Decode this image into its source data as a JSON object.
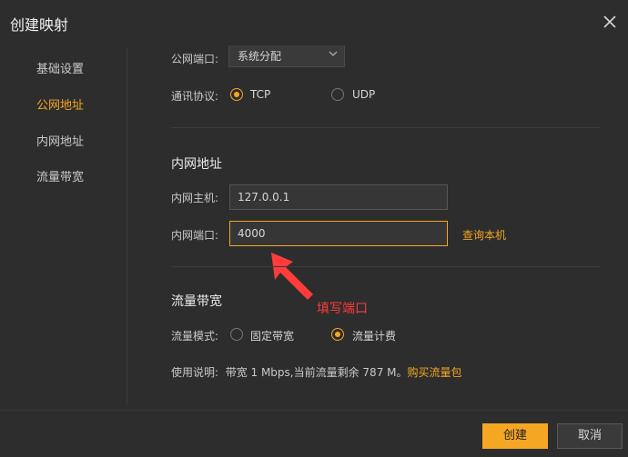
{
  "dialog": {
    "title": "创建映射"
  },
  "sidebar": {
    "items": [
      {
        "label": "基础设置",
        "active": false
      },
      {
        "label": "公网地址",
        "active": true
      },
      {
        "label": "内网地址",
        "active": false
      },
      {
        "label": "流量带宽",
        "active": false
      }
    ]
  },
  "public": {
    "port_label": "公网端口:",
    "port_value": "系统分配",
    "protocol_label": "通讯协议:",
    "protocol_options": [
      "TCP",
      "UDP"
    ],
    "protocol_selected": "TCP"
  },
  "intranet": {
    "section_title": "内网地址",
    "host_label": "内网主机:",
    "host_value": "127.0.0.1",
    "port_label": "内网端口:",
    "port_value": "4000",
    "query_link": "查询本机",
    "annotation": "填写端口"
  },
  "bandwidth": {
    "section_title": "流量带宽",
    "mode_label": "流量模式:",
    "mode_options": [
      "固定带宽",
      "流量计费"
    ],
    "mode_selected": "流量计费",
    "usage_label": "使用说明:",
    "usage_text": "带宽 1 Mbps,当前流量剩余 787 M。",
    "buy_link": "购买流量包"
  },
  "footer": {
    "create_label": "创建",
    "cancel_label": "取消"
  },
  "colors": {
    "accent": "#f5a623",
    "annotation": "#ff3b3b",
    "background": "#2d2d2d"
  },
  "icons": {
    "close": "close-icon",
    "dropdown": "chevron-down-icon"
  }
}
